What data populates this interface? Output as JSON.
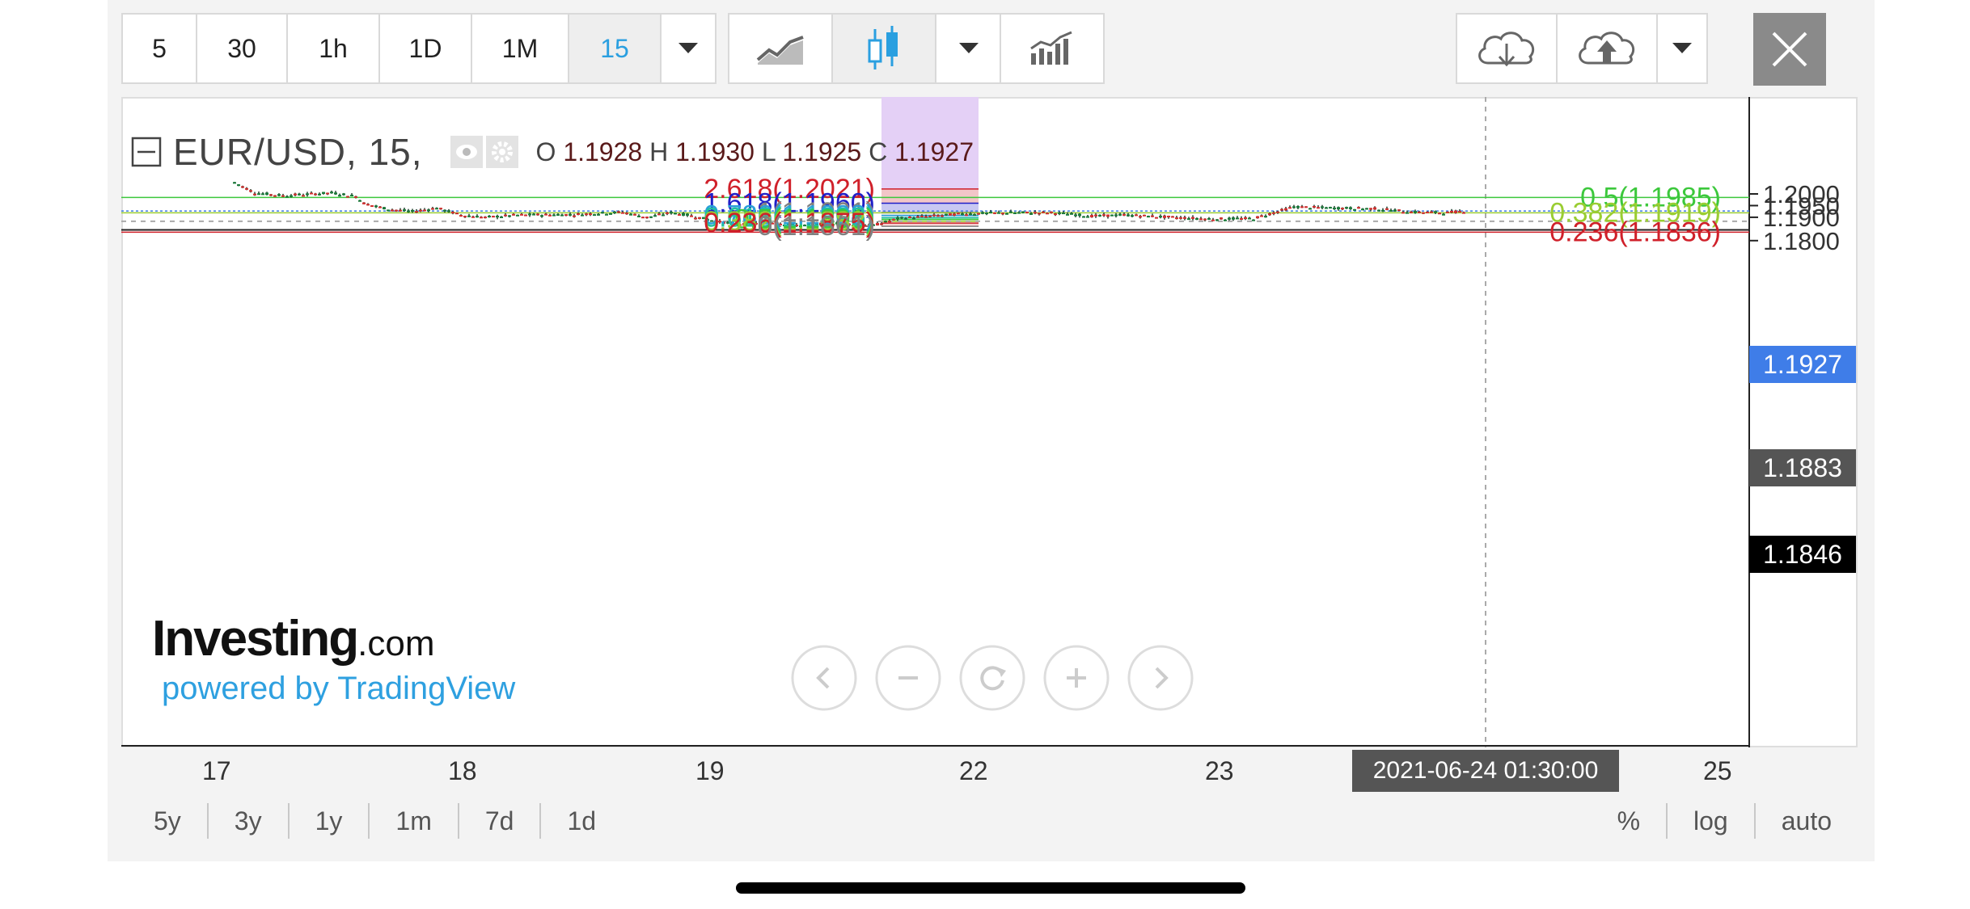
{
  "toolbar": {
    "intervals": [
      "5",
      "30",
      "1h",
      "1D",
      "1M",
      "15"
    ],
    "active_interval": "15"
  },
  "legend": {
    "symbol": "EUR/USD, 15,",
    "o_label": "O",
    "o_value": "1.1928",
    "h_label": "H",
    "h_value": "1.1930",
    "l_label": "L",
    "l_value": "1.1925",
    "c_label": "C",
    "c_value": "1.1927"
  },
  "price_axis": {
    "ticks": [
      "1.2000",
      "1.1950",
      "1.1900",
      "1.1800"
    ],
    "last_price": "1.1927",
    "crosshair_price": "1.1883",
    "line_price": "1.1846"
  },
  "time_axis": {
    "ticks": [
      "17",
      "18",
      "19",
      "22",
      "23",
      "25"
    ],
    "crosshair_time": "2021-06-24 01:30:00"
  },
  "fib_left": [
    {
      "label": "2.618(1.2021)",
      "color": "#d0202a"
    },
    {
      "label": "1.618(1.1960)",
      "color": "#1f1fc8"
    },
    {
      "label": "1(1.1921)",
      "color": "#808080"
    },
    {
      "label": "0.786(1.1908)",
      "color": "#2aa0d8"
    },
    {
      "label": "0.618(1.1898)",
      "color": "#1fc0a0"
    },
    {
      "label": "0.5(1.1891)",
      "color": "#3cc83c"
    },
    {
      "label": "0.382(1.1883)",
      "color": "#9acd32"
    },
    {
      "label": "0.236(1.1875)",
      "color": "#d0202a"
    },
    {
      "label": "0(1.1861)",
      "color": "#808080"
    }
  ],
  "fib_right": [
    {
      "label": "0.5(1.1985)",
      "color": "#3cc83c"
    },
    {
      "label": "0.382(1.1919)",
      "color": "#9acd32"
    },
    {
      "label": "0.236(1.1836)",
      "color": "#d0202a"
    }
  ],
  "branding": {
    "logo_main": "Investing",
    "logo_suffix": ".com",
    "powered": "powered by TradingView"
  },
  "ranges": [
    "5y",
    "3y",
    "1y",
    "1m",
    "7d",
    "1d"
  ],
  "scale_options": [
    "%",
    "log",
    "auto"
  ],
  "colors": {
    "accent": "#2a9fe0",
    "price_badge": "#3f7de8",
    "up": "#1a7a3a",
    "down": "#d32f2f"
  }
}
